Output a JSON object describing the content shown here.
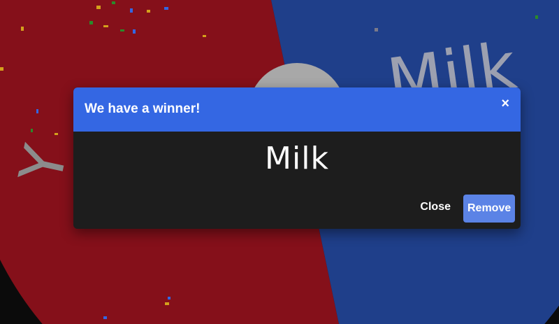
{
  "dialog": {
    "title": "We have a winner!",
    "close_icon": "×",
    "winner": "Milk",
    "close_label": "Close",
    "remove_label": "Remove"
  },
  "wheel": {
    "segment_labels": [
      "Milk",
      "Y"
    ],
    "colors": {
      "red_segment": "#85101a",
      "blue_segment": "#1f3f8a",
      "hub": "#a8a8a8",
      "header": "#3467e3",
      "remove_button": "#5b83e6"
    }
  }
}
